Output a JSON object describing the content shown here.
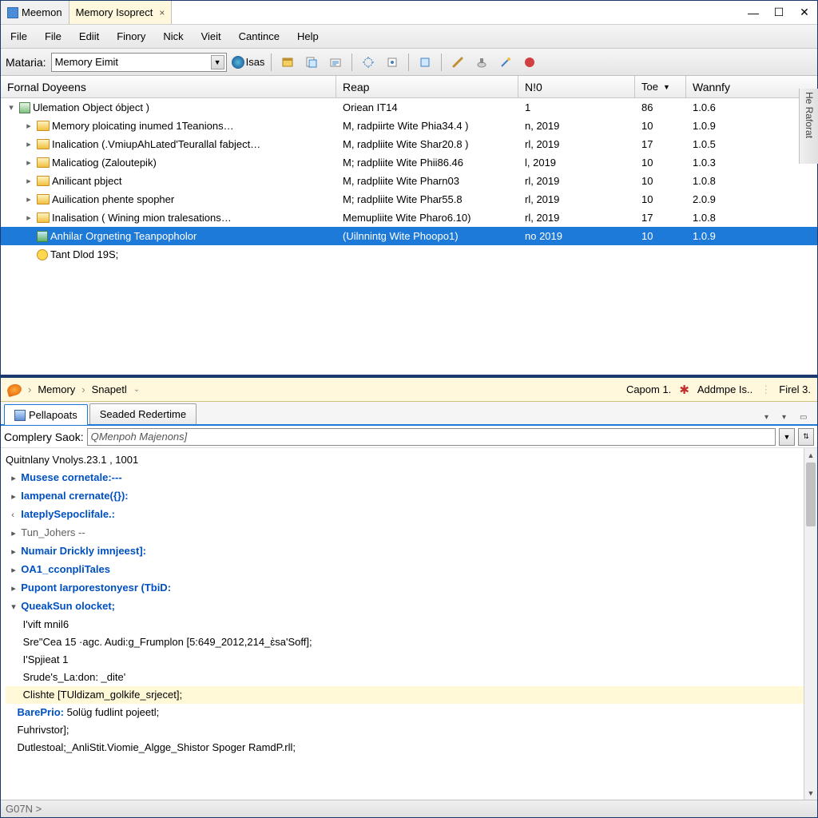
{
  "titlebar": {
    "tabs": [
      {
        "label": "Meemon"
      },
      {
        "label": "Memory Isoprect"
      }
    ],
    "close_x": "×",
    "min": "—",
    "max": "☐",
    "close": "✕"
  },
  "menubar": {
    "items": [
      "File",
      "File",
      "Ediit",
      "Finory",
      "Nick",
      "Vieit",
      "Cantince",
      "Help"
    ]
  },
  "toolbar": {
    "label": "Mataria:",
    "combo_value": "Memory Eimit",
    "isas_label": "Isas"
  },
  "columns": {
    "c0": "Fornal Doyeens",
    "c1": "Reap",
    "c2": "N!0",
    "c3": "Toe",
    "c4": "Wannfy"
  },
  "rows": [
    {
      "indent": 0,
      "tw": "v",
      "icon": "box",
      "label": "Ulemation Object óbject )",
      "c1": "Oriean IT14",
      "c2": "1",
      "c3": "86",
      "c4": "1.0.6"
    },
    {
      "indent": 1,
      "tw": ">",
      "icon": "folder",
      "label": "Memory ploicating inumed 1Teanions…",
      "c1": "M, radpiirte Wite Phia34.4 )",
      "c2": "n, 2019",
      "c3": "10",
      "c4": "1.0.9"
    },
    {
      "indent": 1,
      "tw": ">",
      "icon": "folder",
      "label": "Inalication (.VmiupAhLated'Teurallal fabject…",
      "c1": "M, radpliite Wite Shar20.8 )",
      "c2": "rl, 2019",
      "c3": "17",
      "c4": "1.0.5"
    },
    {
      "indent": 1,
      "tw": ">",
      "icon": "folder",
      "label": "Malicatiog (Zaloutepik)",
      "c1": "M; radpliite Wite Phii86.46",
      "c2": "l, 2019",
      "c3": "10",
      "c4": "1.0.3"
    },
    {
      "indent": 1,
      "tw": ">",
      "icon": "folder",
      "label": "Anilicant pbject",
      "c1": "M, radpliite Wite Pharn03",
      "c2": "rl, 2019",
      "c3": "10",
      "c4": "1.0.8"
    },
    {
      "indent": 1,
      "tw": ">",
      "icon": "folder",
      "label": "Auilication phente spopher",
      "c1": "M; radpliite Wite Phar55.8",
      "c2": "rl, 2019",
      "c3": "10",
      "c4": "2.0.9"
    },
    {
      "indent": 1,
      "tw": ">",
      "icon": "folder",
      "label": "Inalisation ( Wining mion tralesations…",
      "c1": "Memupliite Wite Pharo6.10)",
      "c2": "rl, 2019",
      "c3": "17",
      "c4": "1.0.8"
    },
    {
      "indent": 1,
      "tw": "",
      "icon": "img",
      "label": "Anhilar Orgneting Teanpopholor",
      "c1": "(Uilnnintg Wite Phoopo1)",
      "c2": "no 2019",
      "c3": "10",
      "c4": "1.0.9",
      "selected": true
    },
    {
      "indent": 1,
      "tw": "",
      "icon": "clock",
      "label": "Tant Dlod 19S;",
      "c1": "",
      "c2": "",
      "c3": "",
      "c4": ""
    }
  ],
  "sidebar_label": "He Raforat",
  "breadcrumb": {
    "root": "Memory",
    "leaf": "Snapetl",
    "right1": "Capom 1.",
    "right2": "Addmpe Is..",
    "right3": "Firel 3."
  },
  "subtabs": {
    "active": "Pellapoats",
    "second": "Seaded Redertime"
  },
  "search": {
    "label": "Complery Saok:",
    "value": "QMenpoh Majenons]"
  },
  "code": {
    "header": "Quitnlany Vnolys.23.1 , 1001",
    "lines": [
      {
        "chev": ">",
        "text": "Musese cornetale:---",
        "cls": "fn"
      },
      {
        "chev": ">",
        "text": "Iampenal crernate({}):",
        "cls": "fn"
      },
      {
        "chev": "<",
        "text": "IateplySepoclifale.:",
        "cls": "fn"
      },
      {
        "chev": ">",
        "text": "Tun_Johers --",
        "cls": "tg"
      },
      {
        "chev": ">",
        "text": "Numair Drickly imnjeest]:",
        "cls": "fn"
      },
      {
        "chev": ">",
        "text": "OA1_cconpliTales",
        "cls": "fn"
      },
      {
        "chev": ">",
        "text": "Pupont Iarporestonyesr (TbiD:",
        "cls": "fn"
      },
      {
        "chev": "v",
        "text": "QueakSun olocket;",
        "cls": "kw"
      }
    ],
    "body": [
      "I'vift mnil6",
      "Sre\"Cea 15 ·agc. Audi:g_Frumplon [5:649_2012,214_ɛ̀sa'Soff];",
      "I'Spjieat 1",
      "Srude's_La:don: _dite'",
      "Clishte [TUldizam_golkife_srjecet];"
    ],
    "tail": [
      "BarePrio: 5olüg fudlint pojeetl;",
      "Fuhrivstor];",
      "Dutlestoal;_AnliStit.Viomie_Algge_Shistor Spoger RamdP.rll;"
    ]
  },
  "status": "G07N  >"
}
